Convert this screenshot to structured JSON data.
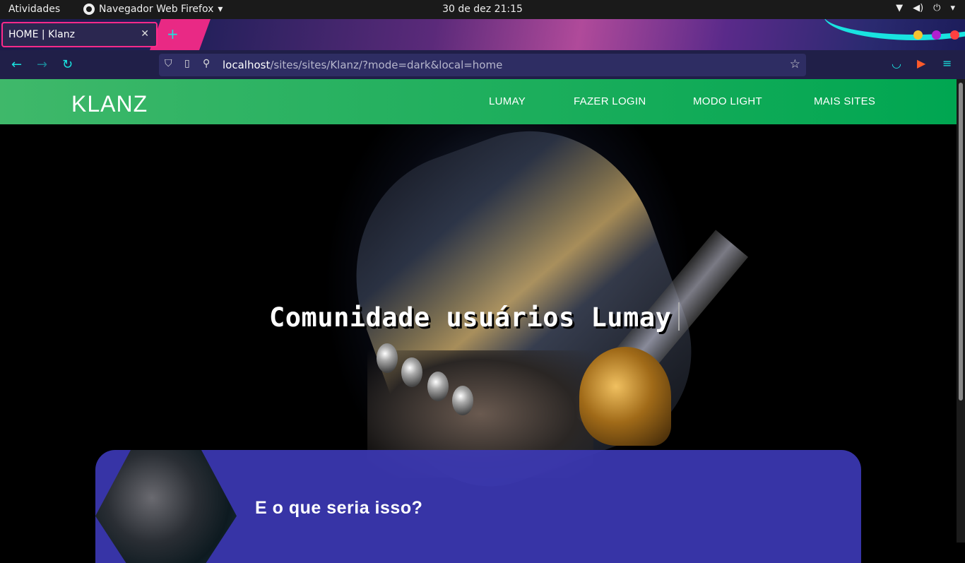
{
  "system_bar": {
    "activities": "Atividades",
    "app_name": "Navegador Web Firefox",
    "datetime": "30 de dez  21:15"
  },
  "browser": {
    "tab_title": "HOME | Klanz",
    "url_host": "localhost",
    "url_rest": "/sites/sites/Klanz/?mode=dark&local=home",
    "accent_color": "#19e3e0"
  },
  "site": {
    "logo": "KLANZ",
    "nav": [
      "LUMAY",
      "FAZER LOGIN",
      "MODO LIGHT",
      "MAIS SITES"
    ],
    "hero_title": "Comunidade usuários Lumay",
    "card_title": "E o que seria isso?",
    "header_color": "#27ae60",
    "card_color": "#3c38b4"
  }
}
